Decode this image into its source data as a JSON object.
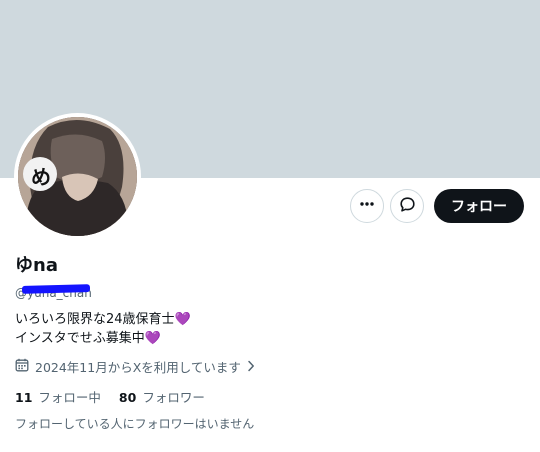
{
  "profile": {
    "display_name": "ゆna",
    "handle": "@yuna_chan",
    "bio_line1": "いろいろ限界な24歳保育士",
    "bio_line2": "インスタでせふ募集中",
    "heart": "💜",
    "joined": "2024年11月からXを利用しています",
    "following_count": "11",
    "following_label": "フォロー中",
    "followers_count": "80",
    "followers_label": "フォロワー",
    "mutual_note": "フォローしている人にフォロワーはいません",
    "avatar_sticker": "め"
  },
  "actions": {
    "more_icon": "more-icon",
    "message_icon": "message-icon",
    "follow_label": "フォロー"
  },
  "colors": {
    "banner": "#cfd9de",
    "follow_button": "#0f1419",
    "secondary_text": "#536471",
    "redaction": "#1414ff"
  }
}
